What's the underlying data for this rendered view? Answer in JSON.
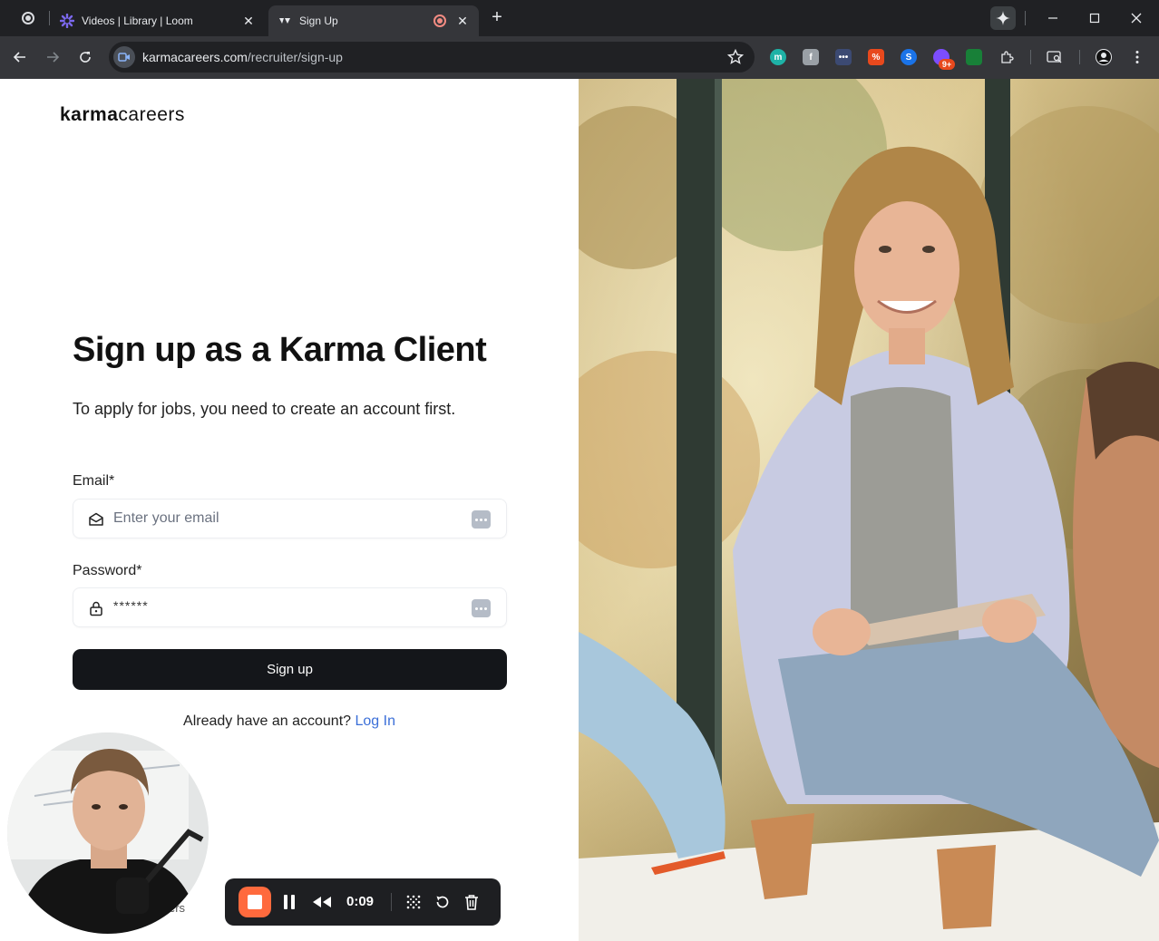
{
  "browser": {
    "tabs": [
      {
        "title": "Videos | Library | Loom",
        "active": false
      },
      {
        "title": "Sign Up",
        "active": true
      }
    ],
    "new_tab_label": "+",
    "url_host": "karmacareers.com",
    "url_path": "/recruiter/sign-up",
    "extension_badge": "9+"
  },
  "page": {
    "logo_bold": "karma",
    "logo_light": "careers",
    "headline": "Sign up as a Karma Client",
    "subheadline": "To apply for jobs, you need to create an account first.",
    "email_label": "Email*",
    "email_placeholder": "Enter your email",
    "password_label": "Password*",
    "password_value": "******",
    "signup_button": "Sign up",
    "login_prompt": "Already have an account?",
    "login_link": "Log In",
    "footer_fragment": "ers"
  },
  "recorder": {
    "elapsed": "0:09"
  },
  "colors": {
    "accent_link": "#3b6fd8",
    "button_bg": "#14161a",
    "recorder_stop": "#ff6a3d"
  }
}
